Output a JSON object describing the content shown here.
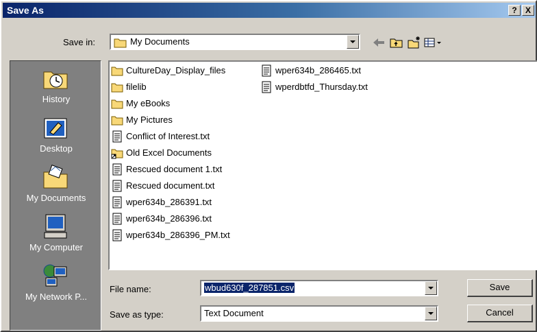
{
  "window": {
    "title": "Save As",
    "help_label": "?",
    "close_label": "X"
  },
  "save_in": {
    "label": "Save in:",
    "value": "My Documents"
  },
  "places": [
    {
      "label": "History",
      "icon": "history-icon"
    },
    {
      "label": "Desktop",
      "icon": "desktop-icon"
    },
    {
      "label": "My Documents",
      "icon": "my-documents-icon"
    },
    {
      "label": "My Computer",
      "icon": "my-computer-icon"
    },
    {
      "label": "My Network P...",
      "icon": "my-network-places-icon"
    }
  ],
  "files": {
    "col1": [
      {
        "name": "CultureDay_Display_files",
        "type": "folder"
      },
      {
        "name": "filelib",
        "type": "folder"
      },
      {
        "name": "My eBooks",
        "type": "folder"
      },
      {
        "name": "My Pictures",
        "type": "folder"
      },
      {
        "name": "Conflict of Interest.txt",
        "type": "text"
      },
      {
        "name": "Old Excel Documents",
        "type": "folder-shortcut"
      },
      {
        "name": "Rescued document 1.txt",
        "type": "text"
      },
      {
        "name": "Rescued document.txt",
        "type": "text"
      },
      {
        "name": "wper634b_286391.txt",
        "type": "text"
      },
      {
        "name": "wper634b_286396.txt",
        "type": "text"
      },
      {
        "name": "wper634b_286396_PM.txt",
        "type": "text"
      }
    ],
    "col2": [
      {
        "name": "wper634b_286465.txt",
        "type": "text"
      },
      {
        "name": "wperdbtfd_Thursday.txt",
        "type": "text"
      }
    ]
  },
  "file_name": {
    "label": "File name:",
    "value": "wbud630f_287851.csv"
  },
  "save_as_type": {
    "label": "Save as type:",
    "value": "Text Document"
  },
  "buttons": {
    "save": "Save",
    "cancel": "Cancel"
  },
  "colors": {
    "title_start": "#0a246a",
    "title_end": "#a6caf0",
    "selection": "#0a246a",
    "folder": "#f8d878"
  }
}
